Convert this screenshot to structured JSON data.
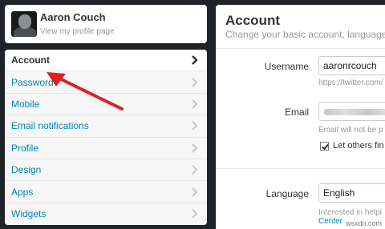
{
  "profile": {
    "name": "Aaron Couch",
    "link_text": "View my profile page"
  },
  "nav": {
    "items": [
      {
        "label": "Account",
        "active": true
      },
      {
        "label": "Password",
        "active": false
      },
      {
        "label": "Mobile",
        "active": false
      },
      {
        "label": "Email notifications",
        "active": false
      },
      {
        "label": "Profile",
        "active": false
      },
      {
        "label": "Design",
        "active": false
      },
      {
        "label": "Apps",
        "active": false
      },
      {
        "label": "Widgets",
        "active": false
      }
    ]
  },
  "account": {
    "title": "Account",
    "subtitle": "Change your basic account, language, T",
    "username_label": "Username",
    "username_value": "aaronrcouch",
    "username_hint": "https://twitter.com/",
    "email_label": "Email",
    "email_hint": "Email will not be p",
    "email_checkbox_label": "Let others fin",
    "email_checkbox_checked": true,
    "language_label": "Language",
    "language_value": "English",
    "language_hint_1": "Interested in helpi",
    "language_hint_2": "Center"
  },
  "watermark": "wsxdn.com",
  "colors": {
    "link": "#0084b4",
    "arrow": "#e02020",
    "background": "#1f2226"
  },
  "icons": {
    "chevron": "chevron-right-icon",
    "checkbox": "check-icon"
  }
}
